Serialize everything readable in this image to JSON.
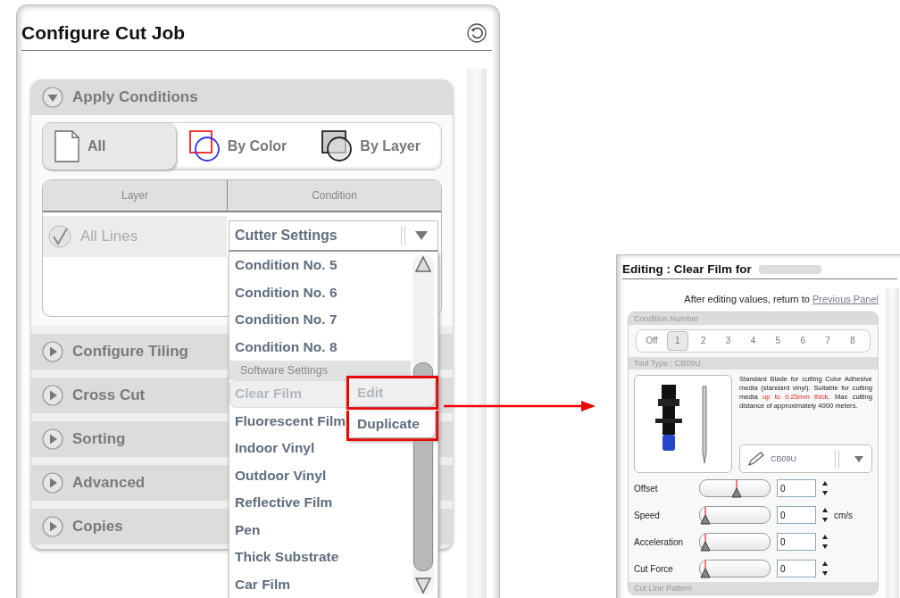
{
  "configure_panel": {
    "title": "Configure Cut Job",
    "sections": [
      {
        "title": "Apply Conditions",
        "expanded": true
      },
      {
        "title": "Configure Tiling",
        "expanded": false
      },
      {
        "title": "Cross Cut",
        "expanded": false
      },
      {
        "title": "Sorting",
        "expanded": false
      },
      {
        "title": "Advanced",
        "expanded": false
      },
      {
        "title": "Copies",
        "expanded": false
      }
    ],
    "apply_tabs": [
      {
        "label": "All",
        "kind": "page",
        "selected": true
      },
      {
        "label": "By Color",
        "kind": "color",
        "selected": false
      },
      {
        "label": "By Layer",
        "kind": "layer",
        "selected": false
      }
    ],
    "table": {
      "columns": [
        "Layer",
        "Condition"
      ],
      "rows": [
        {
          "layer": "All Lines",
          "checked": true,
          "condition": "Cutter Settings"
        }
      ]
    },
    "condition_list": [
      {
        "kind": "option",
        "label": "Condition No. 5",
        "selected": false
      },
      {
        "kind": "option",
        "label": "Condition No. 6",
        "selected": false
      },
      {
        "kind": "option",
        "label": "Condition No. 7",
        "selected": false
      },
      {
        "kind": "option",
        "label": "Condition No. 8",
        "selected": false
      },
      {
        "kind": "group",
        "label": "Software Settings"
      },
      {
        "kind": "option",
        "label": "Clear Film",
        "selected": true
      },
      {
        "kind": "option",
        "label": "Fluorescent Film",
        "selected": false
      },
      {
        "kind": "option",
        "label": "Indoor Vinyl",
        "selected": false
      },
      {
        "kind": "option",
        "label": "Outdoor Vinyl",
        "selected": false
      },
      {
        "kind": "option",
        "label": "Reflective Film",
        "selected": false
      },
      {
        "kind": "option",
        "label": "Pen",
        "selected": false
      },
      {
        "kind": "option",
        "label": "Thick Substrate",
        "selected": false
      },
      {
        "kind": "option",
        "label": "Car Film",
        "selected": false
      }
    ],
    "context_menu": [
      {
        "label": "Edit",
        "disabled": true
      },
      {
        "label": "Duplicate",
        "disabled": false
      }
    ]
  },
  "edit_panel": {
    "title": "Editing : Clear Film for",
    "return_note": "After editing values, return to",
    "return_link": "Previous Panel",
    "condition_number": {
      "heading": "Condition Number",
      "options": [
        {
          "label": "Off",
          "selected": false
        },
        {
          "label": "1",
          "selected": true
        },
        {
          "label": "2",
          "selected": false
        },
        {
          "label": "3",
          "selected": false
        },
        {
          "label": "4",
          "selected": false
        },
        {
          "label": "5",
          "selected": false
        },
        {
          "label": "6",
          "selected": false
        },
        {
          "label": "7",
          "selected": false
        },
        {
          "label": "8",
          "selected": false
        }
      ]
    },
    "tool_type": {
      "heading": "Tool Type : CB09U",
      "description": [
        {
          "text": "Standard Blade for cutting Color Adhesive media (standard vinyl). Suitable for cutting media ",
          "warning": false
        },
        {
          "text": "up to 0.25mm thick",
          "warning": true
        },
        {
          "text": ". Max cutting distance of approximately 4000 meters.",
          "warning": false
        }
      ],
      "selected_tool": "CB09U"
    },
    "settings": [
      {
        "label": "Offset",
        "level": 0.5,
        "value": "0"
      },
      {
        "label": "Speed",
        "level": 0,
        "value": "0",
        "unit": "cm/s"
      },
      {
        "label": "Acceleration",
        "level": 0,
        "value": "0"
      },
      {
        "label": "Cut Force",
        "level": 0,
        "value": "0"
      }
    ],
    "next_heading": "Cut Line Pattern"
  }
}
